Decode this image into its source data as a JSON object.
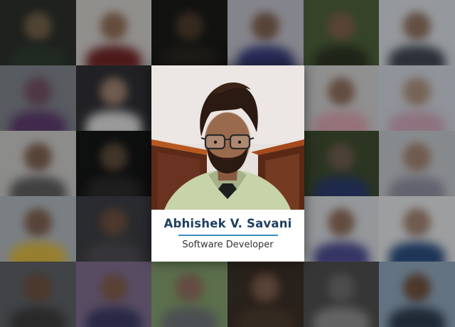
{
  "profile": {
    "name": "Abhishek V. Savani",
    "title": "Software Developer"
  },
  "colors": {
    "name_text": "#1f3f5f",
    "divider": "#3a8fbf",
    "role_text": "#333333",
    "backdrop": "#1b1d1f"
  },
  "background_tiles": [
    {
      "bg": "#2a2e29",
      "skin": "#6f5e48",
      "shirt": "#2e3b30"
    },
    {
      "bg": "#c9c6c3",
      "skin": "#8a6a55",
      "shirt": "#6b2424"
    },
    {
      "bg": "#191a17",
      "skin": "#4a3a2c",
      "shirt": "#2a2622"
    },
    {
      "bg": "#b8b8c2",
      "skin": "#7a5e4e",
      "shirt": "#3a3d7a"
    },
    {
      "bg": "#4b5e3a",
      "skin": "#7b5e4a",
      "shirt": "#2c3322"
    },
    {
      "bg": "#cfd3d8",
      "skin": "#8a6e5e",
      "shirt": "#3e4450"
    },
    {
      "bg": "#7a7e86",
      "skin": "#6e4e5e",
      "shirt": "#5a3a6a"
    },
    {
      "bg": "#2e2f33",
      "skin": "#9a7e6e",
      "shirt": "#d5d5d5"
    },
    {
      "bg": "#ffffff",
      "skin": "#ffffff",
      "shirt": "#ffffff"
    },
    {
      "bg": "#1a1c1a",
      "skin": "#5a4636",
      "shirt": "#4a5a6a"
    },
    {
      "bg": "#c8c8c8",
      "skin": "#8a6a5a",
      "shirt": "#cf9ea8"
    },
    {
      "bg": "#c8ccd4",
      "skin": "#a58c7a",
      "shirt": "#c4a0b0"
    },
    {
      "bg": "#c3c2c0",
      "skin": "#7a5e4e",
      "shirt": "#5a5a5a"
    },
    {
      "bg": "#141516",
      "skin": "#5a4a3a",
      "shirt": "#2a2a2a"
    },
    {
      "bg": "#ffffff",
      "skin": "#ffffff",
      "shirt": "#ffffff"
    },
    {
      "bg": "#303a32",
      "skin": "#7a5a4a",
      "shirt": "#b03a3a"
    },
    {
      "bg": "#3c4a2e",
      "skin": "#6a5a4a",
      "shirt": "#2a3a6a"
    },
    {
      "bg": "#bcc0c4",
      "skin": "#9a7e6e",
      "shirt": "#8a8a9a"
    },
    {
      "bg": "#aab0b6",
      "skin": "#7a5e4e",
      "shirt": "#d0b040"
    },
    {
      "bg": "#3a3c40",
      "skin": "#6a4e3e",
      "shirt": "#4a4a50"
    },
    {
      "bg": "#ffffff",
      "skin": "#ffffff",
      "shirt": "#ffffff"
    },
    {
      "bg": "#2a2d30",
      "skin": "#6a4e3e",
      "shirt": "#3a4a5a"
    },
    {
      "bg": "#cfd2d6",
      "skin": "#8a6a5a",
      "shirt": "#4a4a8a"
    },
    {
      "bg": "#dadcde",
      "skin": "#9a7e6e",
      "shirt": "#2a4a7a"
    },
    {
      "bg": "#5a5e62",
      "skin": "#6a4e3e",
      "shirt": "#3a3a3a"
    },
    {
      "bg": "#7a6a8a",
      "skin": "#7a5a4a",
      "shirt": "#3a3a60"
    },
    {
      "bg": "#7e9a6a",
      "skin": "#8a6a5a",
      "shirt": "#6a6e72"
    },
    {
      "bg": "#3a2e26",
      "skin": "#7a5a4a",
      "shirt": "#4a3a2e"
    },
    {
      "bg": "#4a4c4a",
      "skin": "#6a6a6a",
      "shirt": "#8a8a8a"
    },
    {
      "bg": "#8aa0b4",
      "skin": "#6a4e3e",
      "shirt": "#2a3a4a"
    }
  ]
}
